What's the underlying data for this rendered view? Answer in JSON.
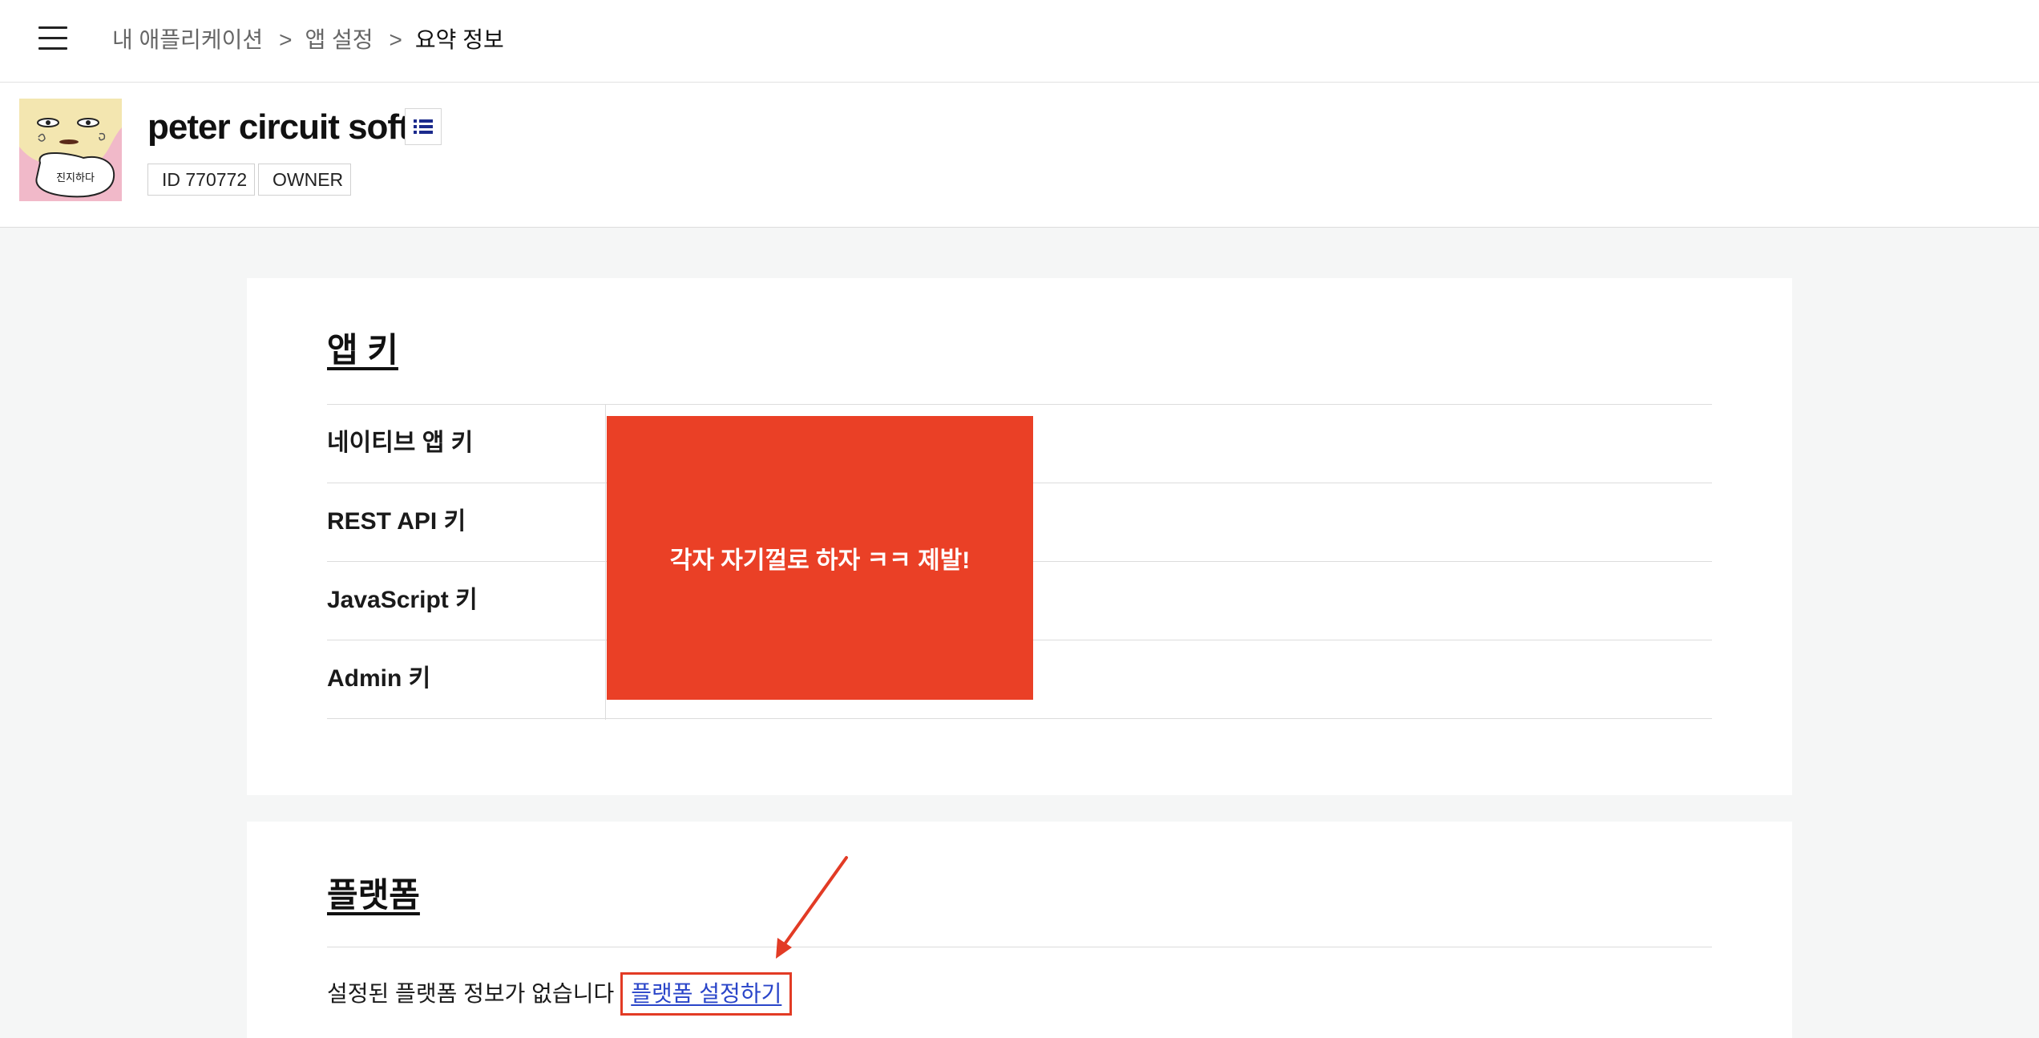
{
  "breadcrumb": {
    "items": [
      "내 애플리케이션",
      "앱 설정",
      "요약 정보"
    ],
    "separator": ">"
  },
  "app": {
    "name": "peter circuit soft",
    "id_tag": "ID 770772",
    "role_tag": "OWNER",
    "icon_text": "진지하다"
  },
  "appkey_section": {
    "title": "앱 키",
    "rows": [
      {
        "label": "네이티브 앱 키",
        "value": ""
      },
      {
        "label": "REST API 키",
        "value": ""
      },
      {
        "label": "JavaScript 키",
        "value": ""
      },
      {
        "label": "Admin 키",
        "value": ""
      }
    ],
    "redaction_text": "각자 자기껄로 하자 ㅋㅋ 제발!"
  },
  "platform_section": {
    "title": "플랫폼",
    "empty_message": "설정된 플랫폼 정보가 없습니다",
    "setup_link": "플랫폼 설정하기"
  },
  "colors": {
    "redaction": "#ea4026",
    "highlight_box": "#e23b25",
    "link": "#2a45c9",
    "list_icon": "#1b2a8c"
  }
}
